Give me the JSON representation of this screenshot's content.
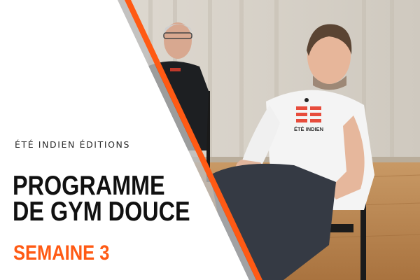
{
  "publisher": "ÉTÉ INDIEN ÉDITIONS",
  "title_lines": [
    "PROGRAMME",
    "DE GYM DOUCE"
  ],
  "week_label": "SEMAINE 3",
  "shirt_text": "ÉTÉ INDIEN",
  "colors": {
    "accent": "#ff5a14",
    "text_dark": "#111111",
    "panel": "#ffffff"
  }
}
